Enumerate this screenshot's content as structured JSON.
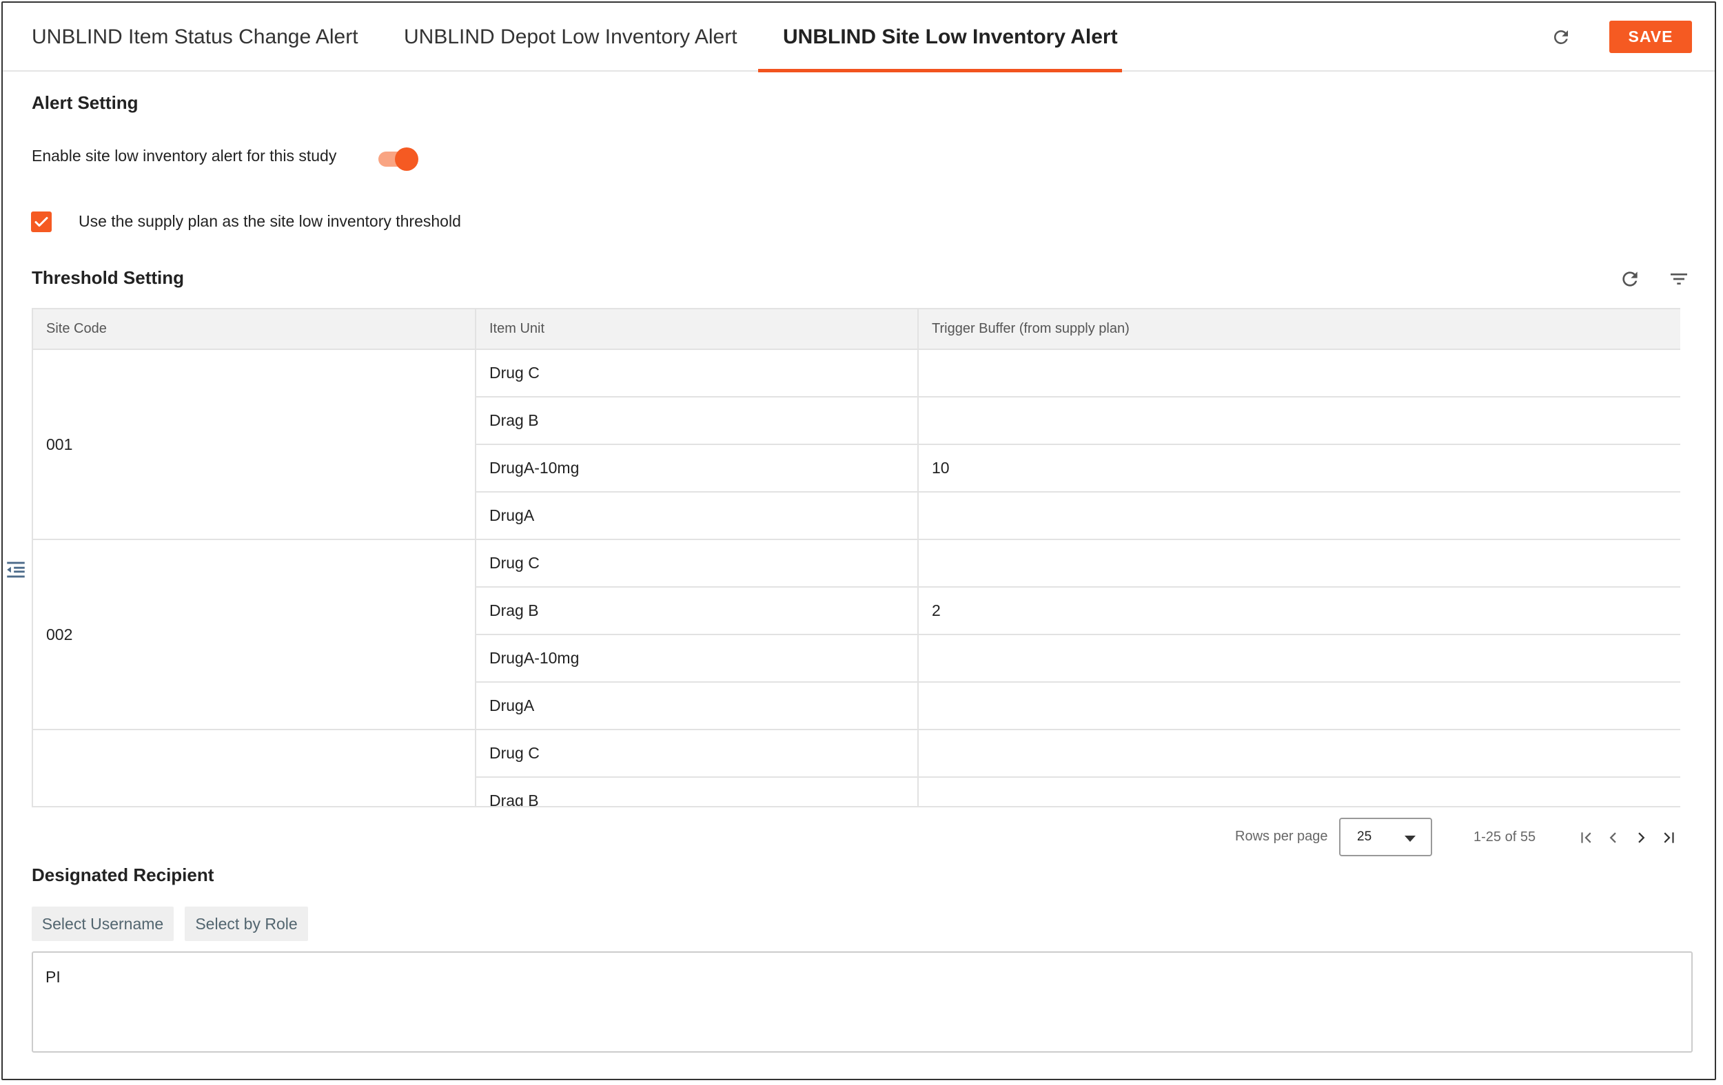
{
  "tabs": [
    {
      "label": "UNBLIND Item Status Change Alert"
    },
    {
      "label": "UNBLIND Depot Low Inventory Alert"
    },
    {
      "label": "UNBLIND Site Low Inventory Alert"
    }
  ],
  "toolbar": {
    "save_label": "SAVE",
    "refresh_icon": "refresh-icon"
  },
  "alert_setting": {
    "title": "Alert Setting",
    "toggle_label": "Enable site low inventory alert for this study",
    "toggle_on": true,
    "checkbox_label": "Use the supply plan as the site low inventory threshold",
    "checkbox_checked": true
  },
  "threshold": {
    "title": "Threshold Setting",
    "columns": [
      "Site Code",
      "Item Unit",
      "Trigger Buffer (from supply plan)"
    ],
    "groups": [
      {
        "site": "001",
        "rows": [
          {
            "item": "Drug C",
            "buffer": ""
          },
          {
            "item": "Drag B",
            "buffer": ""
          },
          {
            "item": "DrugA-10mg",
            "buffer": "10"
          },
          {
            "item": "DrugA",
            "buffer": ""
          }
        ]
      },
      {
        "site": "002",
        "rows": [
          {
            "item": "Drug C",
            "buffer": ""
          },
          {
            "item": "Drag B",
            "buffer": "2"
          },
          {
            "item": "DrugA-10mg",
            "buffer": ""
          },
          {
            "item": "DrugA",
            "buffer": ""
          }
        ]
      },
      {
        "site": "",
        "rows": [
          {
            "item": "Drug C",
            "buffer": ""
          },
          {
            "item": "Drag B",
            "buffer": ""
          }
        ]
      }
    ]
  },
  "pager": {
    "rows_label": "Rows per page",
    "rows_value": "25",
    "range": "1-25 of 55"
  },
  "recipient": {
    "title": "Designated Recipient",
    "select_username": "Select Username",
    "select_role": "Select by Role",
    "value": "PI"
  },
  "colors": {
    "accent": "#f55a22",
    "accent_light": "#f9a482",
    "header_bg": "#f2f2f2",
    "chip_text": "#52656f"
  }
}
